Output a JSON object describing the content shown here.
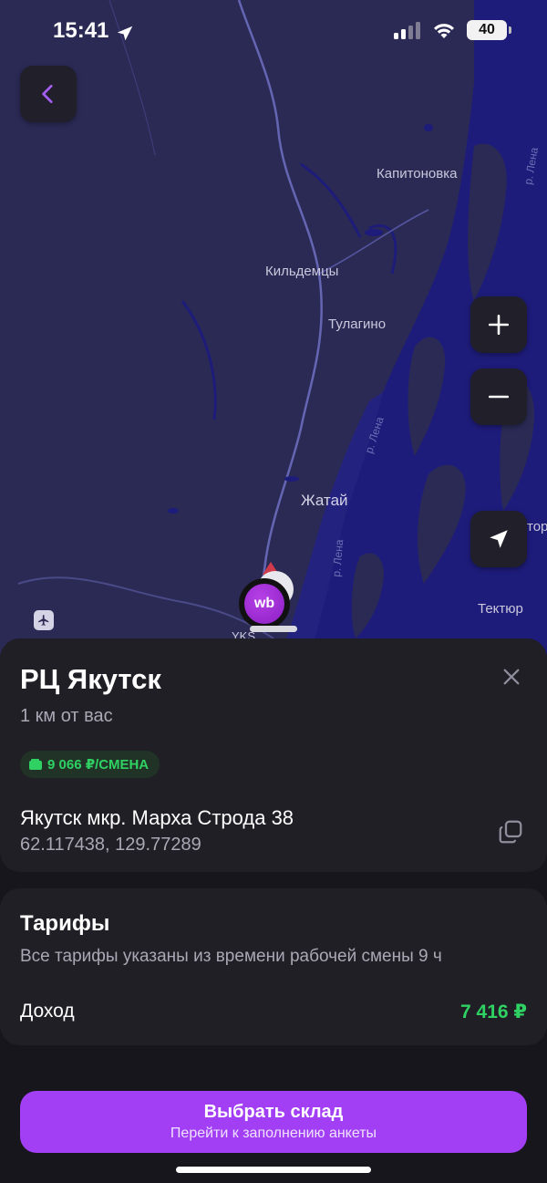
{
  "status_bar": {
    "time": "15:41",
    "battery": "40"
  },
  "map": {
    "places": {
      "kapitonovka": "Капитоновка",
      "kildemtsy": "Кильдемцы",
      "tulagino": "Тулагино",
      "zhatay": "Жатай",
      "tektyur": "Тектюр",
      "yks": "YKS",
      "edge": "тор"
    },
    "river_labels": {
      "lena_1": "р. Лена",
      "lena_2": "р. Лена",
      "lena_3": "р. Лена"
    },
    "marker_label": "wb",
    "icons": [
      "back-arrow-icon",
      "plus-icon",
      "minus-icon",
      "navigation-arrow-icon",
      "airplane-icon"
    ]
  },
  "warehouse": {
    "title": "РЦ Якутск",
    "distance": "1 км от вас",
    "pay_badge": "9 066 ₽/СМЕНА",
    "address": "Якутск мкр. Марха Строда 38",
    "coordinates": "62.117438, 129.77289"
  },
  "tariffs": {
    "title": "Тарифы",
    "note": "Все тарифы указаны из времени рабочей смены 9 ч",
    "income_label": "Доход",
    "income_value": "7 416 ₽"
  },
  "cta": {
    "main": "Выбрать склад",
    "sub": "Перейти к заполнению анкеты"
  },
  "colors": {
    "map_land": "#2b2a55",
    "river": "#1e1c7a",
    "accent": "#a23ff5",
    "money_green": "#2fd262",
    "card": "#201f26"
  }
}
